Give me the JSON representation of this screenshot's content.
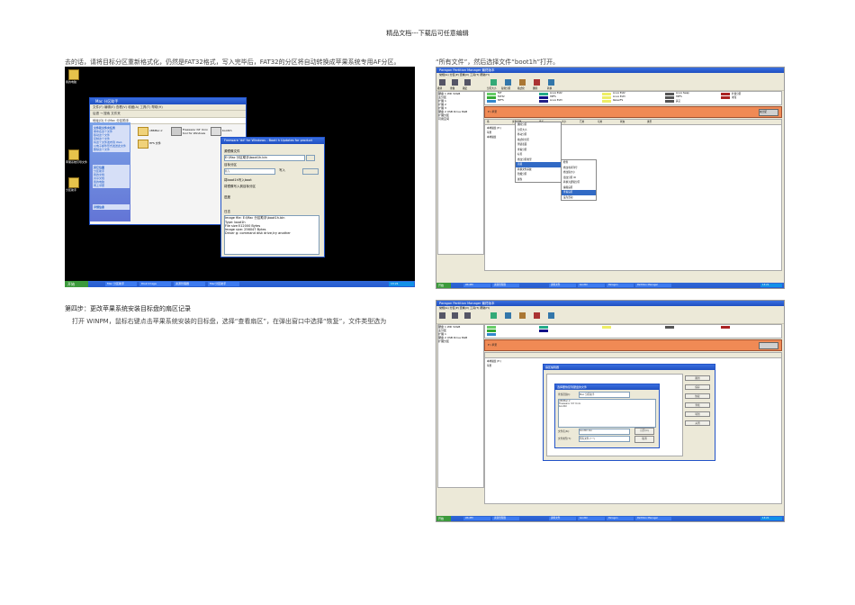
{
  "header": {
    "text": "精品文档---下载后可任意编辑"
  },
  "paragraphs": {
    "top_left": "去的话，请将目标分区重新格式化，仍然是FAT32格式，写入完毕后，FAT32的分区将自动转换成苹果系统专用AF分区。",
    "top_right": "“所有文件”，然后选择文件“boot1h”打开。",
    "step_title": "第四步：更改苹果系统安装目标盘的扇区记录",
    "step_body": "打开 WINPM，鼠标右键点击苹果系统安装的目标盘，选择“查看扇区”，在弹出窗口中选择“恢复”，文件类型选为"
  },
  "xp_screenshot": {
    "desktop_icons": [
      "我的电脑",
      "苹果系统引导文件",
      "分区助手"
    ],
    "explorer_title": "Mac 分区助手",
    "explorer_menu": "文件(F)  编辑(E)  查看(V)  收藏(A)  工具(T)  帮助(H)",
    "explorer_toolbar": "后退  →  搜索  文件夹",
    "explorer_address": "地址(D)  E:\\Mac 分区助手",
    "task_panel_1": {
      "title": "文件和文件夹任务",
      "items": [
        "重命名这个文件",
        "移动这个文件",
        "复制这个文件",
        "将这个文件发布到 Web",
        "以电子邮件形式发送此文件",
        "删除这个文件"
      ]
    },
    "task_panel_2": {
      "title": "其它位置",
      "items": [
        "分区助手",
        "我的文档",
        "共享文档",
        "我的电脑",
        "网上邻居"
      ]
    },
    "task_panel_3": {
      "title": "详细信息"
    },
    "files": [
      "x86Mac.ir",
      "HFS 文件",
      "boot1h",
      "Freeware 'dd' Unix tool for Windows"
    ],
    "dialog": {
      "title": "Freeware 'dd' for Windows - Bootl h Updates for product",
      "source_label": "源镜像文件",
      "source_value": "E:\\Mac 分区助手\\boot1h.bin",
      "target_label": "目标分区",
      "target_value": "\\\\.\\",
      "write_button": "写入",
      "opt1": "将boot1h写入boot",
      "opt2": "将镜像写入到目标分区",
      "progress_label": "进度",
      "log_label": "日志",
      "log_lines": [
        "Image file: E:\\Mac 分区助手\\boot1h.bin",
        "Type: boot1h",
        "File size:512000 Bytes",
        "Image size: 256047 Bytes",
        "Driver g: command disk drive,try another"
      ]
    },
    "taskbar": {
      "start": "开始",
      "buttons": [
        "Mac 分区助手",
        "Disk Image",
        "资源管理器",
        "Mac分区助手"
      ],
      "clock": "13:21"
    }
  },
  "pm_common": {
    "title": "Paragon Partition Manager 最终版本",
    "menu": "常规(G)  分区(P)  查看(V)  工具(T)  帮助(H)",
    "toolbar": [
      "撤消",
      "重做",
      "确定",
      "分区大小",
      "复制分区",
      "格式化",
      "删除",
      "转换"
    ],
    "tree": [
      "硬盘 1 WD 32GB",
      "主分区",
      "扩展 1",
      "扩展 2",
      "扩展 3",
      "硬盘 2 USB Drive 8GB",
      "扩展分区",
      "可用空间"
    ],
    "legend": [
      "FAT",
      "FAT32",
      "NTFS",
      "Linux Ext2",
      "Linux Swap",
      "HPFS",
      "Linux Ext3",
      "ReiserFS",
      "扩展分区",
      "未知",
      "其它",
      "删除"
    ],
    "bar_label": "E:\\ 苹果",
    "bar_side": "未分配",
    "grid_headers": [
      "卷",
      "文件系统",
      "卷标",
      "大小",
      "已用",
      "可用",
      "状态",
      "类型"
    ],
    "grid_rows": [
      "本地磁盘 (E:)",
      "苹果",
      "本地磁盘",
      "FAT32",
      "未分配"
    ],
    "taskbar": {
      "start": "开始",
      "buttons": [
        "WinPM",
        "资源管理器",
        "资料文件",
        "boot1h",
        "Paragon",
        "Partition Manager"
      ],
      "clock": "13:21"
    }
  },
  "pm1_context": [
    "删除分区",
    "分区大小",
    "移动分区",
    "格式化分区",
    "测试表面",
    "查看分区",
    "标签",
    "修改分区类型",
    "高级",
    "转换文件系统",
    "隐藏分区",
    "属性"
  ],
  "pm1_submenu": [
    "检查",
    "查看扇区",
    "修改卷序列号",
    "修改簇大小",
    "更改分区 ID",
    "转换为逻辑分区",
    "设为活动",
    "编辑扇区"
  ],
  "pm2_dialog": {
    "outer_title": "扇区编辑器",
    "open_title": "选择要恢复到硬盘的文件",
    "lookin_label": "查找范围(I):",
    "lookin_value": "Mac 分区助手",
    "files": [
      "x86Mac.ir",
      "Freeware 'dd' Unix",
      "boot1h"
    ],
    "filename_label": "文件名(N):",
    "filename_value": "boot1h.bin",
    "filetype_label": "文件类型(T):",
    "filetype_value": "所有文件 (*.*)",
    "open_button": "打开(O)",
    "cancel_button": "取消",
    "side_buttons": [
      "跳到",
      "保存",
      "恢复",
      "查找",
      "转到",
      "关闭"
    ]
  }
}
